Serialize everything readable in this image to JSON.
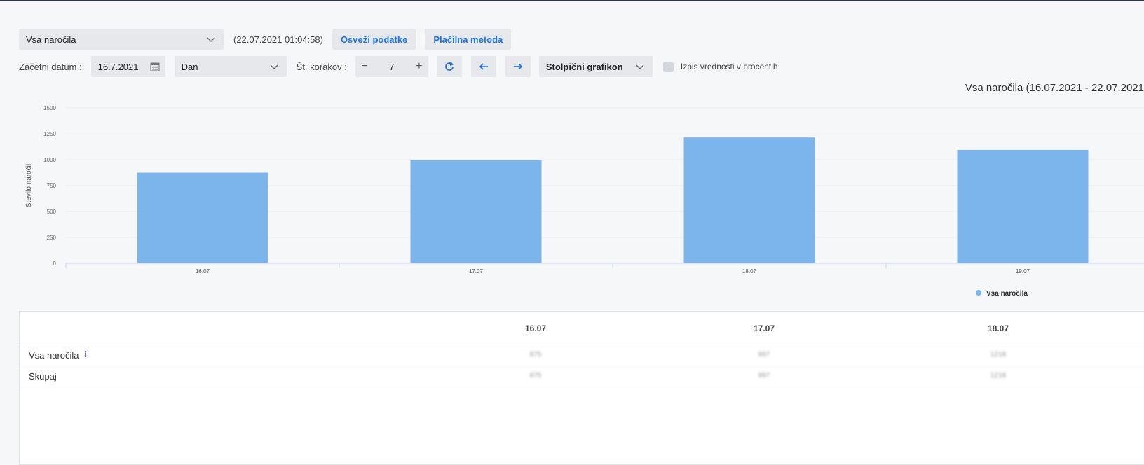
{
  "filters": {
    "report_select": "Vsa naročila",
    "timestamp": "(22.07.2021 01:04:58)",
    "refresh_label": "Osveži podatke",
    "payment_method_label": "Plačilna metoda",
    "start_date_label": "Začetni datum :",
    "start_date_value": "16.7.2021",
    "interval_select": "Dan",
    "steps_label": "Št. korakov :",
    "steps_value": "7",
    "chart_type_select": "Stolpični grafikon",
    "percent_checkbox_label": "Izpis vrednosti v procentih",
    "percent_checked": false
  },
  "chart_data": {
    "type": "bar",
    "title": "Vsa naročila (16.07.2021 - 22.07.2021",
    "ylabel": "Število naročil",
    "xlabel": "",
    "ylim": [
      0,
      1500
    ],
    "yticks": [
      0,
      250,
      500,
      750,
      1000,
      1250,
      1500
    ],
    "categories": [
      "16.07",
      "17.07",
      "18.07",
      "19.07"
    ],
    "series": [
      {
        "name": "Vsa naročila",
        "values": [
          875,
          995,
          1215,
          1095
        ],
        "color": "#7cb5ec"
      }
    ],
    "grid": true,
    "legend": "bottom-right"
  },
  "table": {
    "columns": [
      "16.07",
      "17.07",
      "18.07"
    ],
    "rows": [
      {
        "label": "Vsa naročila",
        "info_icon": "info-icon",
        "cells": [
          "875",
          "997",
          "1218"
        ]
      },
      {
        "label": "Skupaj",
        "cells": [
          "875",
          "997",
          "1218"
        ]
      }
    ]
  },
  "icons": {
    "calendar": "calendar-icon",
    "refresh": "refresh-icon",
    "prev": "arrow-left-icon",
    "next": "arrow-right-icon",
    "dropdown": "chevron-down-icon"
  },
  "colors": {
    "accent": "#1a73e8",
    "bar": "#7cb5ec",
    "info": "#1a1ad6"
  }
}
